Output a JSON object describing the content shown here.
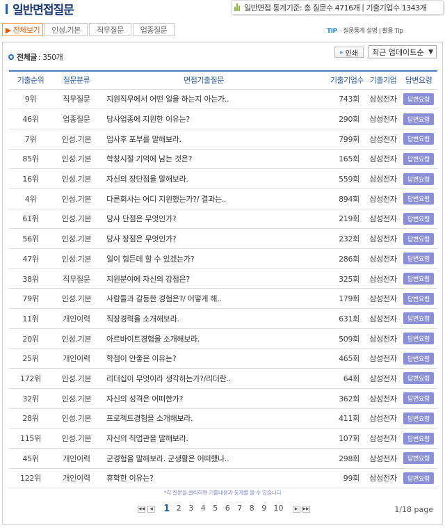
{
  "header": {
    "title": "일반면접질문",
    "stats_prefix": "일반면접 통계기준: 총 질문수",
    "question_count": "4716개",
    "separator": "|",
    "company_label": "기출기업수",
    "company_count": "1343개"
  },
  "tabs": [
    {
      "label": "▶ 전체보기",
      "active": true
    },
    {
      "label": "인성.기본"
    },
    {
      "label": "직무질문"
    },
    {
      "label": "업종질문"
    }
  ],
  "tip": {
    "label": "TIP",
    "text": "· 질문통계 설명 | 활용 Tip"
  },
  "summary": {
    "label": "전체글",
    "value": ": 350개"
  },
  "print_label": "인쇄",
  "sort": {
    "selected": "최근 업데이트순"
  },
  "table": {
    "headers": [
      "기출순위",
      "질문분류",
      "면접기출질문",
      "기출기업수",
      "기출기업",
      "답변요령"
    ],
    "rows": [
      [
        "9위",
        "직무질문",
        "지원직무에서 어떤 일을 하는지 아는가..",
        "743회",
        "삼성전자",
        "답변요령"
      ],
      [
        "46위",
        "업종질문",
        "당사업종에 지원한 이유는?",
        "290회",
        "삼성전자",
        "답변요령"
      ],
      [
        "7위",
        "인성.기본",
        "입사후 포부를 말해보라.",
        "799회",
        "삼성전자",
        "답변요령"
      ],
      [
        "85위",
        "인성.기본",
        "학창시절 기억에 남는 것은?",
        "165회",
        "삼성전자",
        "답변요령"
      ],
      [
        "16위",
        "인성.기본",
        "자신의 장단점을 말해보라.",
        "559회",
        "삼성전자",
        "답변요령"
      ],
      [
        "4위",
        "인성.기본",
        "다른회사는 어디 지원했는가?/ 결과는..",
        "894회",
        "삼성전자",
        "답변요령"
      ],
      [
        "61위",
        "인성.기본",
        "당사 단점은 무엇인가?",
        "219회",
        "삼성전자",
        "답변요령"
      ],
      [
        "56위",
        "인성.기본",
        "당사 장점은 무엇인가?",
        "232회",
        "삼성전자",
        "답변요령"
      ],
      [
        "47위",
        "인성.기본",
        "일이 힘든데 할 수 있겠는가?",
        "286회",
        "삼성전자",
        "답변요령"
      ],
      [
        "38위",
        "직무질문",
        "지원분야에 자신의 강점은?",
        "325회",
        "삼성전자",
        "답변요령"
      ],
      [
        "79위",
        "인성.기본",
        "사람들과 갈등한 경험은?/ 어떻게 해..",
        "179회",
        "삼성전자",
        "답변요령"
      ],
      [
        "11위",
        "개인이력",
        "직장경력을 소개해보라.",
        "631회",
        "삼성전자",
        "답변요령"
      ],
      [
        "20위",
        "인성.기본",
        "아르바이트경험을 소개해보라.",
        "509회",
        "삼성전자",
        "답변요령"
      ],
      [
        "25위",
        "개인이력",
        "학점이 안좋은 이유는?",
        "465회",
        "삼성전자",
        "답변요령"
      ],
      [
        "172위",
        "인성.기본",
        "리더십이 무엇이라 생각하는가?/리더란..",
        "64회",
        "삼성전자",
        "답변요령"
      ],
      [
        "32위",
        "인성.기본",
        "자신의 성격은 어떠한가?",
        "362회",
        "삼성전자",
        "답변요령"
      ],
      [
        "28위",
        "인성.기본",
        "프로젝트경험을 소개해보라.",
        "411회",
        "삼성전자",
        "답변요령"
      ],
      [
        "115위",
        "인성.기본",
        "자신의 직업관을 말해보라.",
        "107회",
        "삼성전자",
        "답변요령"
      ],
      [
        "45위",
        "개인이력",
        "군경험을 말해보라. 군생활은 어떠했나..",
        "298회",
        "삼성전자",
        "답변요령"
      ],
      [
        "122위",
        "개인이력",
        "휴학한 이유는?",
        "99회",
        "삼성전자",
        "답변요령"
      ]
    ]
  },
  "note": "*각 질문을 클릭하면 기출내용과 통계를 볼 수 있습니다",
  "pager": {
    "pages": [
      "1",
      "2",
      "3",
      "4",
      "5",
      "6",
      "7",
      "8",
      "9",
      "10"
    ],
    "current": "1",
    "info": "1/18 page"
  }
}
